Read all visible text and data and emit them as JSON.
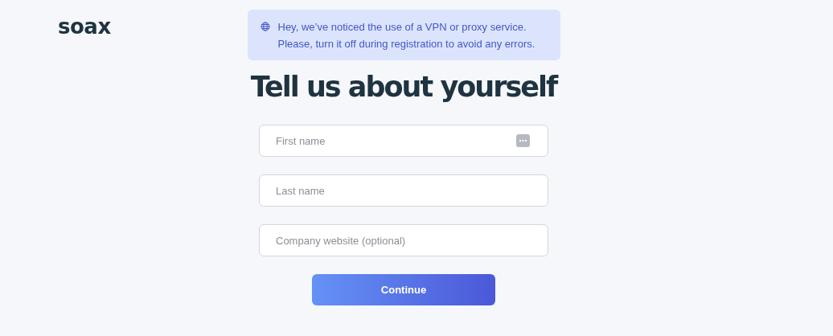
{
  "logo": "soax",
  "notice": {
    "lines": [
      "Hey, we’ve noticed the use of a VPN or proxy service.",
      "Please, turn it off during registration to avoid any errors."
    ]
  },
  "heading": "Tell us about yourself",
  "fields": [
    {
      "placeholder": "First name",
      "kind": "autofill"
    },
    {
      "placeholder": "Last name",
      "kind": "plain"
    },
    {
      "placeholder": "Company website (optional)",
      "kind": "plain"
    }
  ],
  "button": "Continue"
}
